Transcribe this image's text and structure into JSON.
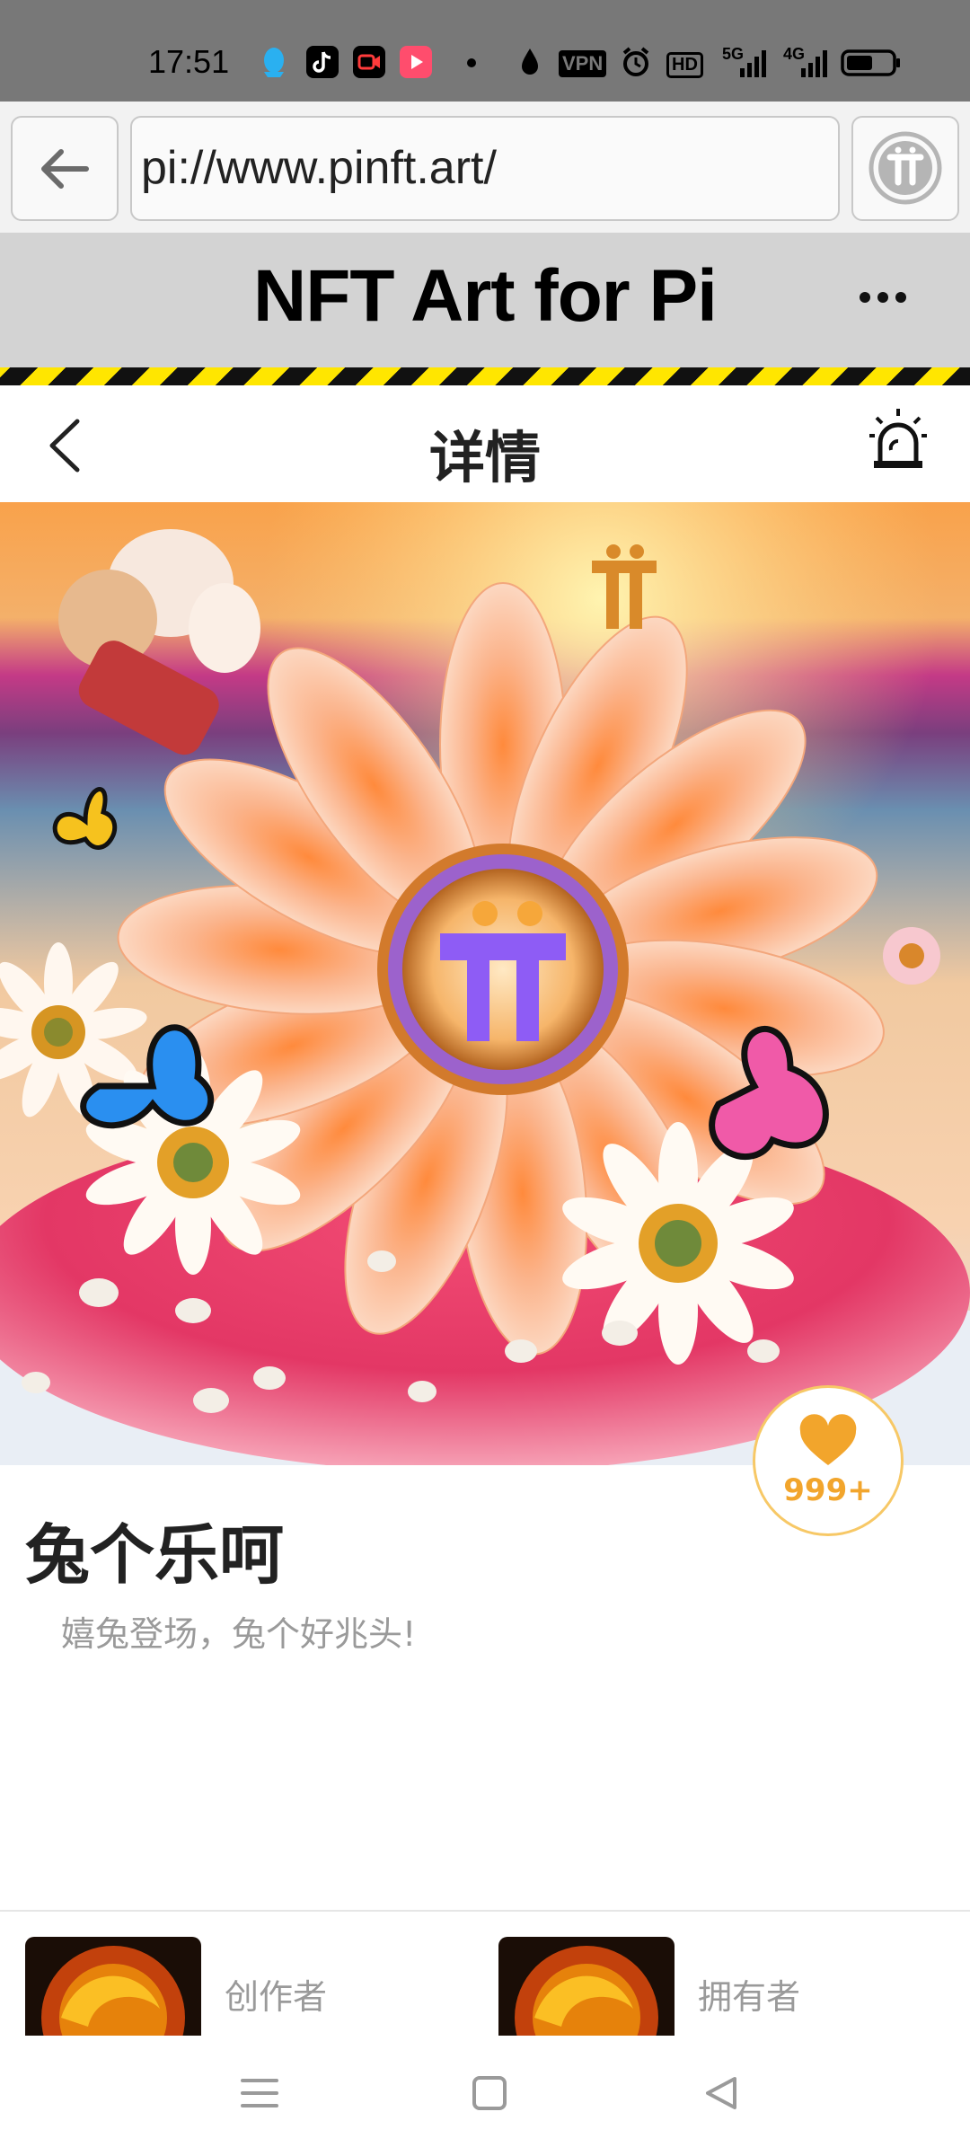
{
  "status": {
    "time": "17:51",
    "vpn": "VPN",
    "hd": "HD",
    "net1": "5G",
    "net2": "4G"
  },
  "browser": {
    "url": "pi://www.pinft.art/"
  },
  "app": {
    "title": "NFT Art for Pi"
  },
  "nav": {
    "title": "详情"
  },
  "art": {
    "title": "兔个乐呵",
    "description": "嬉兔登场，兔个好兆头!",
    "likes": "999+"
  },
  "people": [
    {
      "label": "创作者"
    },
    {
      "label": "拥有者"
    }
  ],
  "colors": {
    "status_bar": "#787878",
    "header": "#d3d3d3",
    "accent": "#f2a52c",
    "purple": "#8e5cf5"
  }
}
